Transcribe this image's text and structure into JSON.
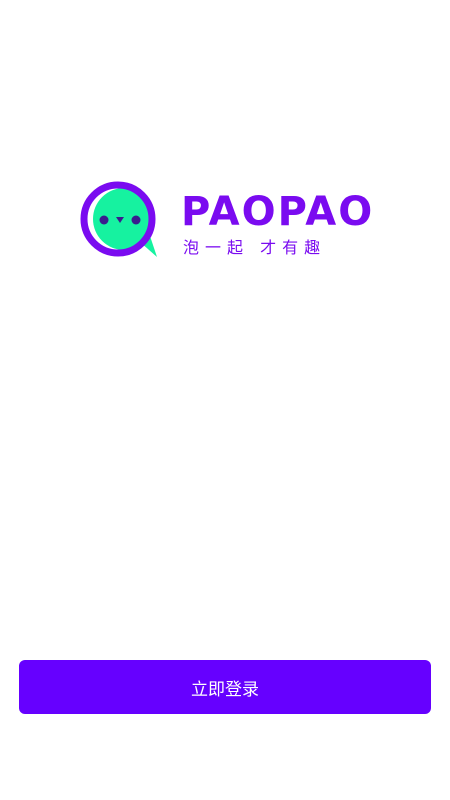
{
  "brand": {
    "name": "PAOPAO",
    "tagline": "泡一起 才有趣",
    "primary_color": "#7a0bf0",
    "accent_color": "#16f2a0",
    "icon": "chat-bubble-logo-icon"
  },
  "actions": {
    "login_label": "立即登录",
    "login_color": "#6600ff"
  }
}
